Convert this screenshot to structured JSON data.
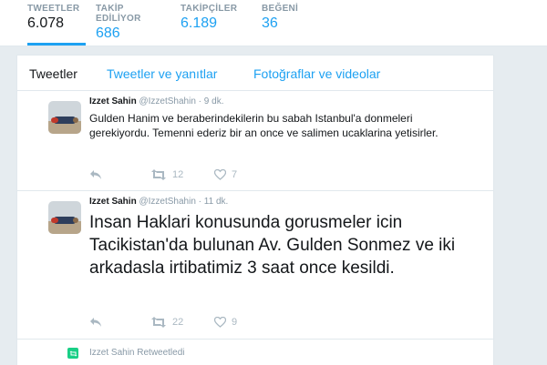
{
  "stats": [
    {
      "label": "TWEETLER",
      "value": "6.078"
    },
    {
      "label": "TAKİP EDİLİYOR",
      "value": "686"
    },
    {
      "label": "TAKİPÇİLER",
      "value": "6.189"
    },
    {
      "label": "BEĞENİ",
      "value": "36"
    }
  ],
  "tabs": [
    {
      "label": "Tweetler"
    },
    {
      "label": "Tweetler ve yanıtlar"
    },
    {
      "label": "Fotoğraflar ve videolar"
    }
  ],
  "tweets": [
    {
      "name": "Izzet Sahin",
      "handle": "@IzzetShahin",
      "separator": "·",
      "time": "9 dk.",
      "text": "Gulden Hanim ve beraberindekilerin bu sabah Istanbul'a donmeleri gerekiyordu. Temenni ederiz bir an once ve salimen ucaklarina yetisirler.",
      "retweets": "12",
      "likes": "7"
    },
    {
      "name": "Izzet Sahin",
      "handle": "@IzzetShahin",
      "separator": "·",
      "time": "11 dk.",
      "text": "Insan Haklari konusunda gorusmeler icin Tacikistan'da bulunan Av. Gulden Sonmez ve iki arkadasla irtibatimiz 3 saat once kesildi.",
      "retweets": "22",
      "likes": "9"
    }
  ],
  "retweet_notice": "Izzet Sahin Retweetledi",
  "colors": {
    "accent": "#1da1f2",
    "retweet_green": "#19cf86",
    "muted": "#8899a6"
  }
}
